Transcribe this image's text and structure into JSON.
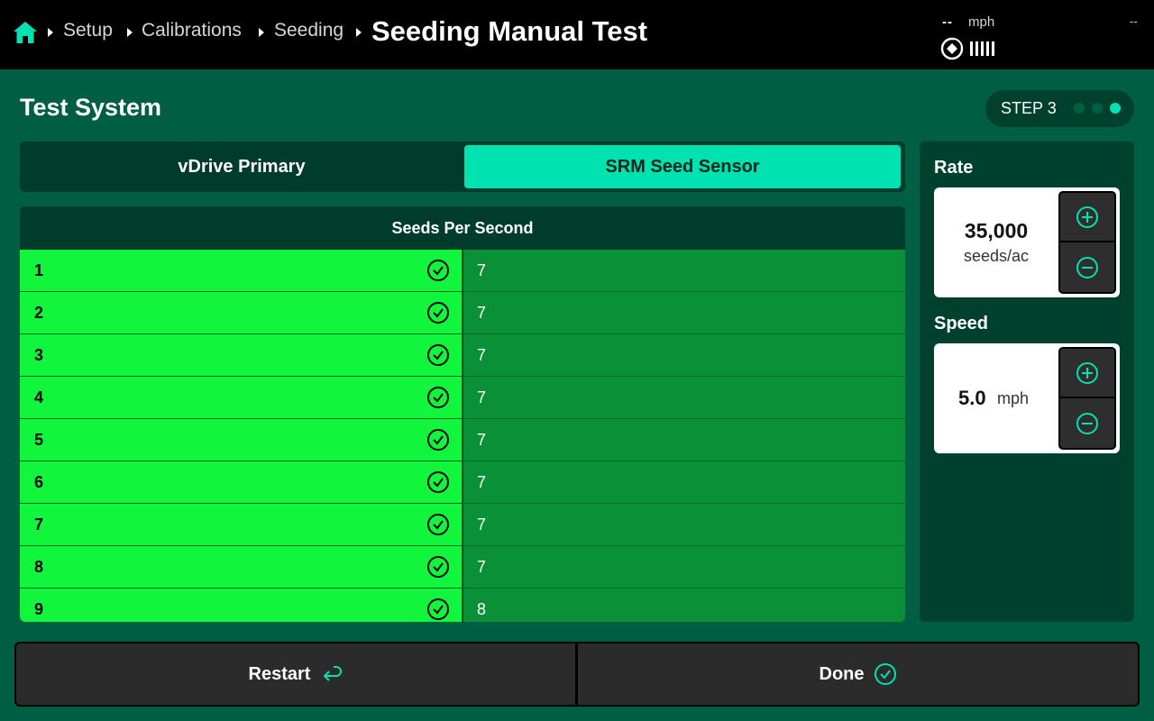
{
  "header": {
    "breadcrumb": [
      {
        "label": "Setup"
      },
      {
        "label": "Calibrations"
      },
      {
        "label": "Seeding"
      }
    ],
    "current_page": "Seeding Manual Test",
    "speed_value": "--",
    "speed_unit": "mph",
    "top_right_value": "--",
    "icons": {
      "home": "home-icon",
      "gps": "gps-satellite-icon",
      "signal": "signal-bars-icon"
    }
  },
  "section": {
    "title": "Test System",
    "step_label": "STEP 3",
    "step_total": 3,
    "step_current": 3
  },
  "tabs": [
    {
      "label": "vDrive Primary",
      "active": false
    },
    {
      "label": "SRM Seed Sensor",
      "active": true
    }
  ],
  "table": {
    "header": "Seeds Per Second",
    "rows": [
      {
        "row": "1",
        "value": "7"
      },
      {
        "row": "2",
        "value": "7"
      },
      {
        "row": "3",
        "value": "7"
      },
      {
        "row": "4",
        "value": "7"
      },
      {
        "row": "5",
        "value": "7"
      },
      {
        "row": "6",
        "value": "7"
      },
      {
        "row": "7",
        "value": "7"
      },
      {
        "row": "8",
        "value": "7"
      },
      {
        "row": "9",
        "value": "8"
      }
    ]
  },
  "side_panel": {
    "rate": {
      "label": "Rate",
      "value": "35,000",
      "unit": "seeds/ac"
    },
    "speed": {
      "label": "Speed",
      "value": "5.0",
      "unit": "mph"
    }
  },
  "buttons": {
    "restart_label": "Restart",
    "done_label": "Done"
  },
  "colors": {
    "background": "#005e43",
    "accent": "#00e2b0",
    "row_status_ok": "#11f53c",
    "row_value_bg": "#0a9137"
  }
}
